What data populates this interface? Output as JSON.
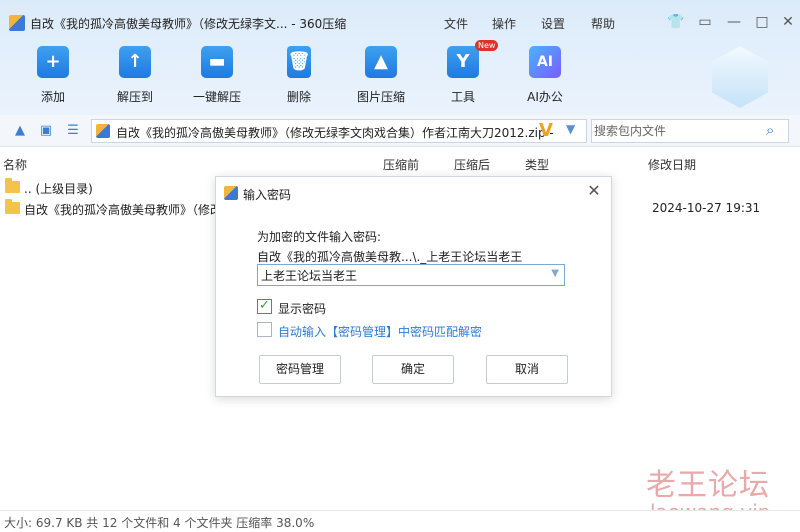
{
  "window": {
    "title": "自改《我的孤冷高傲美母教师》（修改无绿李文... - 360压缩",
    "menu": [
      "文件",
      "操作",
      "设置",
      "帮助"
    ]
  },
  "toolbar": {
    "add": "添加",
    "extract_to": "解压到",
    "one_click_extract": "一键解压",
    "delete": "删除",
    "image_compress": "图片压缩",
    "tools": "工具",
    "tools_badge": "New",
    "ai_office": "AI办公",
    "ai_icon_text": "AI"
  },
  "address": {
    "path": "自改《我的孤冷高傲美母教师》（修改无绿李文肉戏合集）作者江南大刀2012.zip -",
    "search_placeholder": "搜索包内文件"
  },
  "list": {
    "headers": {
      "name": "名称",
      "before": "压缩前",
      "after": "压缩后",
      "type": "类型",
      "modified": "修改日期"
    },
    "rows": [
      {
        "name": ".. (上级目录)",
        "date": ""
      },
      {
        "name": "自改《我的孤冷高傲美母教师》（修改",
        "date": "2024-10-27 19:31"
      }
    ]
  },
  "status": "大小: 69.7 KB 共 12 个文件和 4 个文件夹 压缩率 38.0%",
  "watermark": {
    "cn": "老王论坛",
    "en": "laowang.vip"
  },
  "dialog": {
    "title": "输入密码",
    "prompt": "为加密的文件输入密码:",
    "filename": "自改《我的孤冷高傲美母教...\\._上老王论坛当老王",
    "password": "上老王论坛当老王",
    "show_password": "显示密码",
    "show_password_checked": true,
    "auto_input": "自动输入【密码管理】中密码匹配解密",
    "auto_input_checked": false,
    "btn_manage": "密码管理",
    "btn_ok": "确定",
    "btn_cancel": "取消"
  }
}
